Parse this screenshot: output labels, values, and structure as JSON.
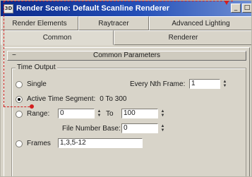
{
  "window": {
    "title": "Render Scene: Default Scanline Renderer",
    "icon_label": "3D",
    "minimize_icon": "minimize-icon",
    "maximize_icon": "maximize-icon"
  },
  "tabs": {
    "back_row": [
      "Render Elements",
      "Raytracer",
      "Advanced Lighting"
    ],
    "front_row": [
      "Common",
      "Renderer"
    ],
    "active": "Common"
  },
  "rollout": {
    "toggle": "−",
    "title": "Common Parameters"
  },
  "time_output": {
    "group_label": "Time Output",
    "single_label": "Single",
    "every_nth_label": "Every Nth Frame:",
    "every_nth_value": "1",
    "active_segment_label": "Active Time Segment:",
    "active_segment_value": "0 To 300",
    "range_label": "Range:",
    "range_from": "0",
    "range_to_label": "To",
    "range_to": "100",
    "file_base_label": "File Number Base:",
    "file_base_value": "0",
    "frames_label": "Frames",
    "frames_value": "1,3,5-12"
  },
  "colors": {
    "title_bar": "#0b2a8a",
    "annotation": "#d31f1f",
    "panel": "#d8d4c9"
  }
}
